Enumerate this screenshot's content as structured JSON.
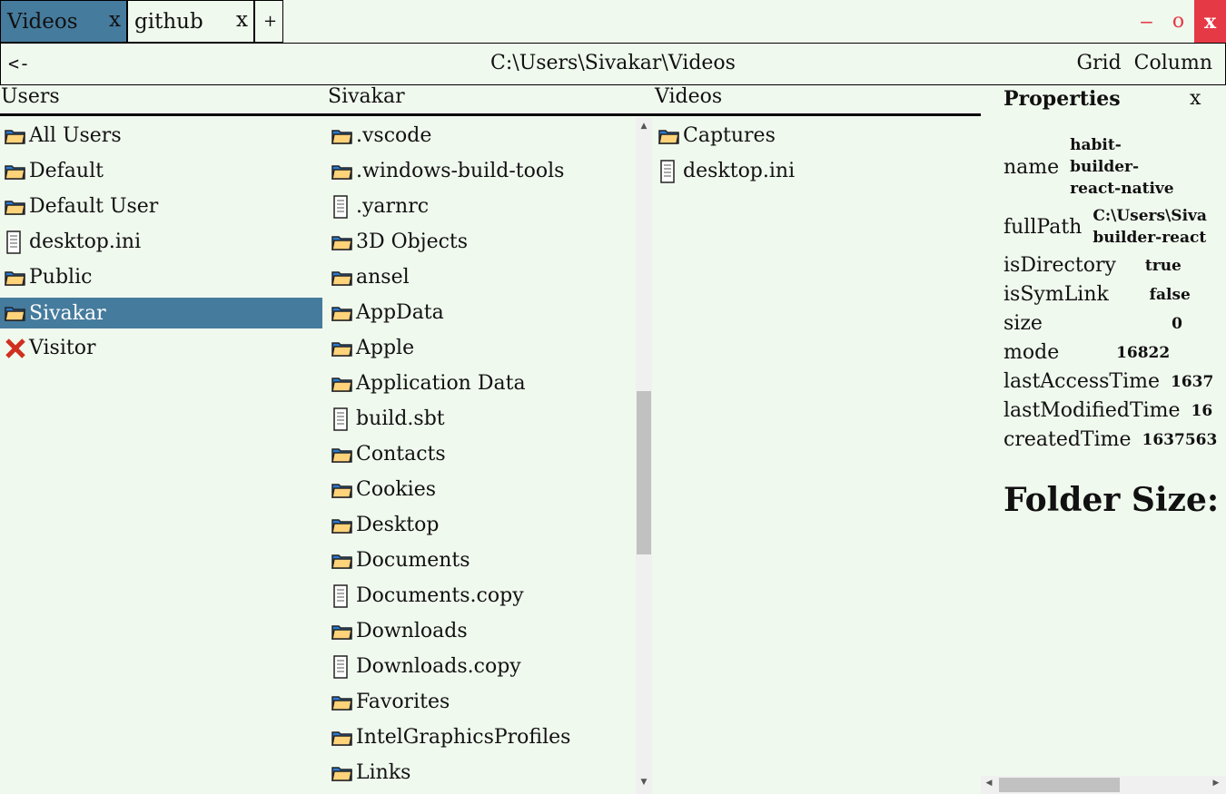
{
  "tabs": [
    {
      "label": "Videos",
      "close": "x",
      "active": true
    },
    {
      "label": "github",
      "close": "x",
      "active": false
    }
  ],
  "add_tab": "+",
  "window": {
    "minimize": "−",
    "maximize": "o",
    "close": "x",
    "close_bg": "#e63946"
  },
  "address": {
    "back": "<-",
    "path": "C:\\Users\\Sivakar\\Videos",
    "grid": "Grid",
    "column": "Column"
  },
  "accent": "#457b9d",
  "columns": [
    {
      "title": "Users",
      "items": [
        {
          "name": "All Users",
          "icon": "folder-icon"
        },
        {
          "name": "Default",
          "icon": "folder-icon"
        },
        {
          "name": "Default User",
          "icon": "folder-icon"
        },
        {
          "name": "desktop.ini",
          "icon": "file-icon"
        },
        {
          "name": "Public",
          "icon": "folder-icon"
        },
        {
          "name": "Sivakar",
          "icon": "folder-icon",
          "selected": true
        },
        {
          "name": "Visitor",
          "icon": "error-icon"
        }
      ]
    },
    {
      "title": "Sivakar",
      "items": [
        {
          "name": ".vscode",
          "icon": "folder-icon"
        },
        {
          "name": ".windows-build-tools",
          "icon": "folder-icon"
        },
        {
          "name": ".yarnrc",
          "icon": "file-icon"
        },
        {
          "name": "3D Objects",
          "icon": "folder-icon"
        },
        {
          "name": "ansel",
          "icon": "folder-icon"
        },
        {
          "name": "AppData",
          "icon": "folder-icon"
        },
        {
          "name": "Apple",
          "icon": "folder-icon"
        },
        {
          "name": "Application Data",
          "icon": "folder-icon"
        },
        {
          "name": "build.sbt",
          "icon": "file-icon"
        },
        {
          "name": "Contacts",
          "icon": "folder-icon"
        },
        {
          "name": "Cookies",
          "icon": "folder-icon"
        },
        {
          "name": "Desktop",
          "icon": "folder-icon"
        },
        {
          "name": "Documents",
          "icon": "folder-icon"
        },
        {
          "name": "Documents.copy",
          "icon": "file-icon"
        },
        {
          "name": "Downloads",
          "icon": "folder-icon"
        },
        {
          "name": "Downloads.copy",
          "icon": "file-icon"
        },
        {
          "name": "Favorites",
          "icon": "folder-icon"
        },
        {
          "name": "IntelGraphicsProfiles",
          "icon": "folder-icon"
        },
        {
          "name": "Links",
          "icon": "folder-icon"
        }
      ]
    },
    {
      "title": "Videos",
      "items": [
        {
          "name": "Captures",
          "icon": "folder-icon"
        },
        {
          "name": "desktop.ini",
          "icon": "file-icon"
        }
      ]
    }
  ],
  "properties": {
    "title": "Properties",
    "close": "x",
    "rows": [
      {
        "key": "name",
        "value": "habit-\nbuilder-\nreact-native"
      },
      {
        "key": "fullPath",
        "value": "C:\\Users\\Siva\nbuilder-react"
      },
      {
        "key": "isDirectory",
        "value": "true"
      },
      {
        "key": "isSymLink",
        "value": "false"
      },
      {
        "key": "size",
        "value": "0"
      },
      {
        "key": "mode",
        "value": "16822"
      },
      {
        "key": "lastAccessTime",
        "value": "1637"
      },
      {
        "key": "lastModifiedTime",
        "value": "16"
      },
      {
        "key": "createdTime",
        "value": "1637563"
      }
    ],
    "folder_size_label": "Folder Size:"
  }
}
